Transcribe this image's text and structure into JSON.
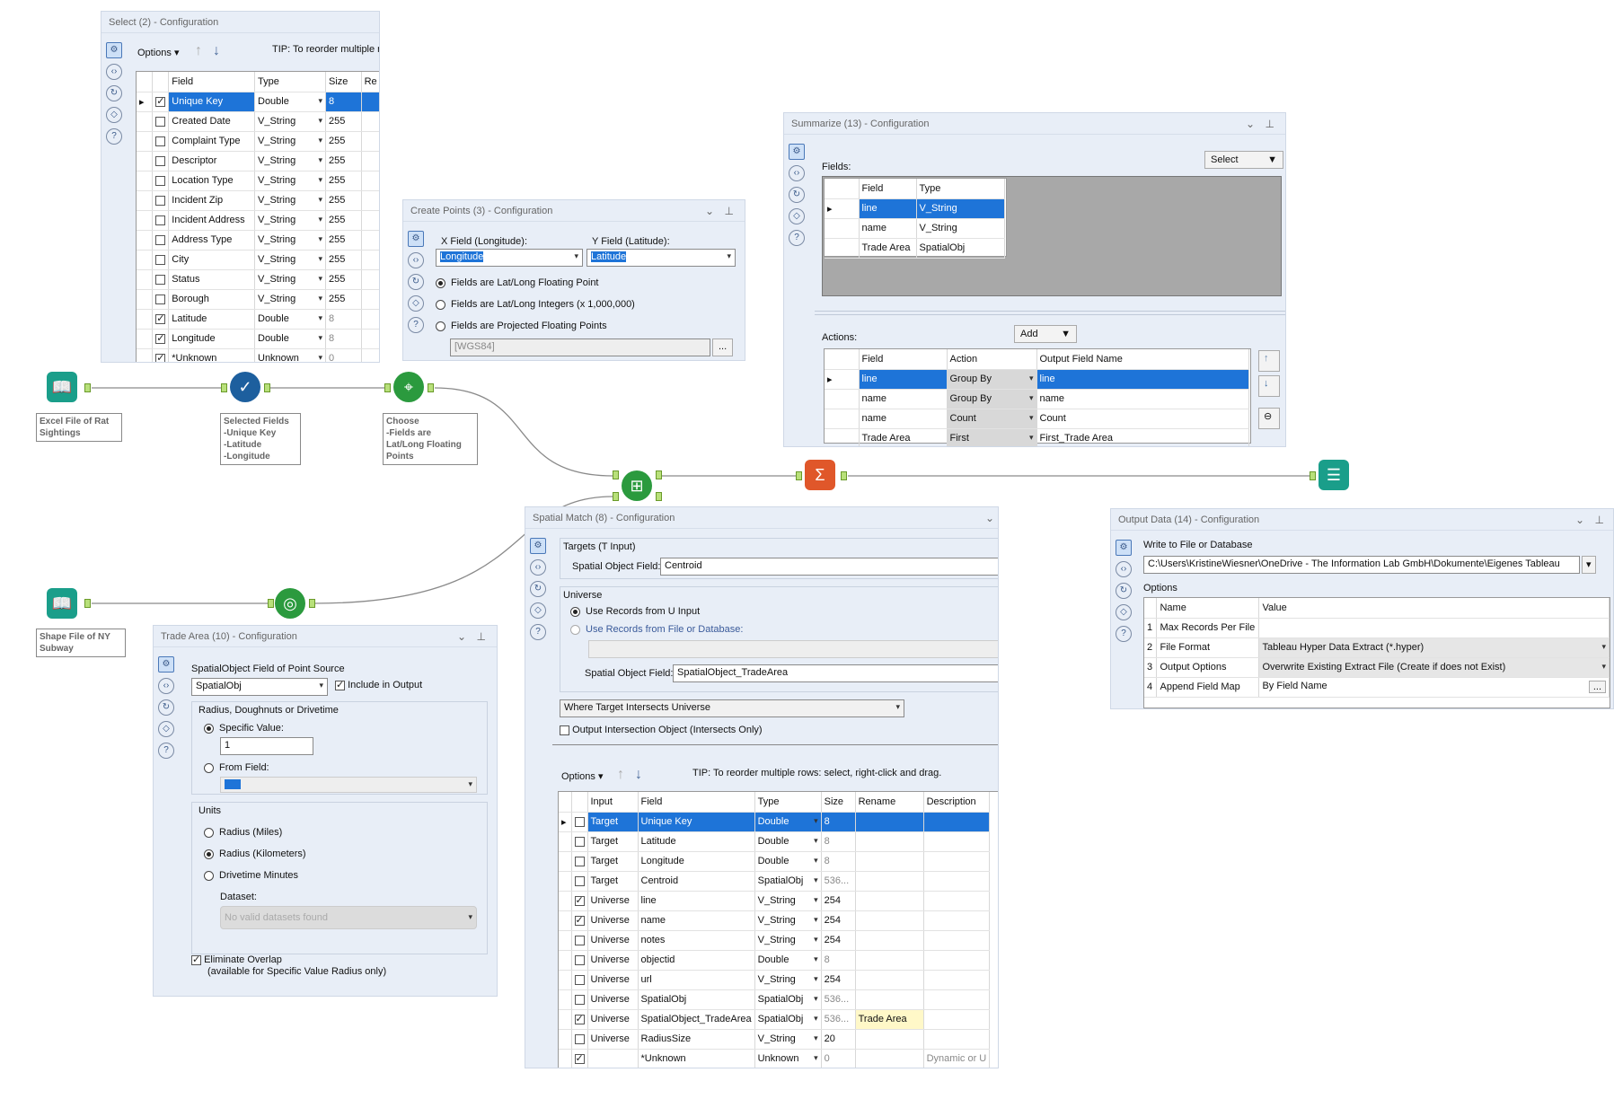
{
  "canvas": {
    "nodes": [
      {
        "id": "excel",
        "icon": "book-icon",
        "color": "#1a9e8a",
        "label": "Excel File of Rat Sightings"
      },
      {
        "id": "select",
        "icon": "check-icon",
        "color": "#1d5f9e",
        "label": "Selected Fields\n-Unique Key\n-Latitude\n-Longitude"
      },
      {
        "id": "createpoints",
        "icon": "pin-icon",
        "color": "#2b9a3e",
        "label": "Choose\n-Fields are\nLat/Long Floating\nPoints"
      },
      {
        "id": "spatialmatch",
        "icon": "match-icon",
        "color": "#2b9a3e",
        "label": ""
      },
      {
        "id": "summarize",
        "icon": "sigma-icon",
        "color": "#e0572a",
        "label": ""
      },
      {
        "id": "output",
        "icon": "output-icon",
        "color": "#1a9e8a",
        "label": ""
      },
      {
        "id": "subway",
        "icon": "book-icon",
        "color": "#1a9e8a",
        "label": "Shape File of NY Subway"
      },
      {
        "id": "tradearea",
        "icon": "target-icon",
        "color": "#2b9a3e",
        "label": ""
      }
    ],
    "anchors": {
      "t": "T",
      "u": "U",
      "m": "M",
      "d": "D"
    }
  },
  "select_panel": {
    "title": "Select (2) - Configuration",
    "options": "Options",
    "tip": "TIP: To reorder multiple ro",
    "headers": [
      "Field",
      "Type",
      "Size",
      "Re"
    ],
    "rows": [
      {
        "checked": true,
        "field": "Unique Key",
        "type": "Double",
        "size": "8",
        "selected": true
      },
      {
        "checked": false,
        "field": "Created Date",
        "type": "V_String",
        "size": "255"
      },
      {
        "checked": false,
        "field": "Complaint Type",
        "type": "V_String",
        "size": "255"
      },
      {
        "checked": false,
        "field": "Descriptor",
        "type": "V_String",
        "size": "255"
      },
      {
        "checked": false,
        "field": "Location Type",
        "type": "V_String",
        "size": "255"
      },
      {
        "checked": false,
        "field": "Incident Zip",
        "type": "V_String",
        "size": "255"
      },
      {
        "checked": false,
        "field": "Incident Address",
        "type": "V_String",
        "size": "255"
      },
      {
        "checked": false,
        "field": "Address Type",
        "type": "V_String",
        "size": "255"
      },
      {
        "checked": false,
        "field": "City",
        "type": "V_String",
        "size": "255"
      },
      {
        "checked": false,
        "field": "Status",
        "type": "V_String",
        "size": "255"
      },
      {
        "checked": false,
        "field": "Borough",
        "type": "V_String",
        "size": "255"
      },
      {
        "checked": true,
        "field": "Latitude",
        "type": "Double",
        "size": "8"
      },
      {
        "checked": true,
        "field": "Longitude",
        "type": "Double",
        "size": "8"
      },
      {
        "checked": true,
        "field": "*Unknown",
        "type": "Unknown",
        "size": "0"
      }
    ]
  },
  "create_points": {
    "title": "Create Points (3) - Configuration",
    "x_label": "X Field (Longitude):",
    "x_value": "Longitude",
    "y_label": "Y Field (Latitude):",
    "y_value": "Latitude",
    "opt1": "Fields are Lat/Long Floating Point",
    "opt2": "Fields are Lat/Long Integers (x 1,000,000)",
    "opt3": "Fields are Projected Floating Points",
    "proj": "[WGS84]",
    "proj_btn": "..."
  },
  "summarize": {
    "title": "Summarize (13) - Configuration",
    "fields_label": "Fields:",
    "select_btn": "Select",
    "field_headers": [
      "Field",
      "Type"
    ],
    "fields": [
      {
        "field": "line",
        "type": "V_String",
        "selected": true
      },
      {
        "field": "name",
        "type": "V_String"
      },
      {
        "field": "Trade Area",
        "type": "SpatialObj"
      }
    ],
    "add_btn": "Add",
    "actions_label": "Actions:",
    "action_headers": [
      "Field",
      "Action",
      "Output Field Name"
    ],
    "actions": [
      {
        "field": "line",
        "action": "Group By",
        "out": "line",
        "selected": true
      },
      {
        "field": "name",
        "action": "Group By",
        "out": "name"
      },
      {
        "field": "name",
        "action": "Count",
        "out": "Count"
      },
      {
        "field": "Trade Area",
        "action": "First",
        "out": "First_Trade Area"
      }
    ]
  },
  "spatial_match": {
    "title": "Spatial Match (8) - Configuration",
    "targets_label": "Targets (T Input)",
    "spatial_field_label": "Spatial Object Field:",
    "target_field": "Centroid",
    "universe_label": "Universe",
    "use_u": "Use Records from U Input",
    "use_file": "Use Records from File or Database:",
    "universe_field": "SpatialObject_TradeArea",
    "match_type": "Where Target Intersects Universe",
    "output_intersection": "Output Intersection Object (Intersects Only)",
    "options": "Options",
    "tip": "TIP: To reorder multiple rows: select, right-click and drag.",
    "headers": [
      "Input",
      "Field",
      "Type",
      "Size",
      "Rename",
      "Description"
    ],
    "rows": [
      {
        "checked": false,
        "input": "Target",
        "field": "Unique Key",
        "type": "Double",
        "size": "8",
        "rename": "",
        "desc": "",
        "selected": true
      },
      {
        "checked": false,
        "input": "Target",
        "field": "Latitude",
        "type": "Double",
        "size": "8",
        "rename": "",
        "desc": ""
      },
      {
        "checked": false,
        "input": "Target",
        "field": "Longitude",
        "type": "Double",
        "size": "8",
        "rename": "",
        "desc": ""
      },
      {
        "checked": false,
        "input": "Target",
        "field": "Centroid",
        "type": "SpatialObj",
        "size": "536...",
        "rename": "",
        "desc": ""
      },
      {
        "checked": true,
        "input": "Universe",
        "field": "line",
        "type": "V_String",
        "size": "254",
        "rename": "",
        "desc": ""
      },
      {
        "checked": true,
        "input": "Universe",
        "field": "name",
        "type": "V_String",
        "size": "254",
        "rename": "",
        "desc": ""
      },
      {
        "checked": false,
        "input": "Universe",
        "field": "notes",
        "type": "V_String",
        "size": "254",
        "rename": "",
        "desc": ""
      },
      {
        "checked": false,
        "input": "Universe",
        "field": "objectid",
        "type": "Double",
        "size": "8",
        "rename": "",
        "desc": ""
      },
      {
        "checked": false,
        "input": "Universe",
        "field": "url",
        "type": "V_String",
        "size": "254",
        "rename": "",
        "desc": ""
      },
      {
        "checked": false,
        "input": "Universe",
        "field": "SpatialObj",
        "type": "SpatialObj",
        "size": "536...",
        "rename": "",
        "desc": ""
      },
      {
        "checked": true,
        "input": "Universe",
        "field": "SpatialObject_TradeArea",
        "type": "SpatialObj",
        "size": "536...",
        "rename": "Trade Area",
        "desc": ""
      },
      {
        "checked": false,
        "input": "Universe",
        "field": "RadiusSize",
        "type": "V_String",
        "size": "20",
        "rename": "",
        "desc": ""
      },
      {
        "checked": true,
        "input": "",
        "field": "*Unknown",
        "type": "Unknown",
        "size": "0",
        "rename": "",
        "desc": "Dynamic or U"
      }
    ]
  },
  "output_data": {
    "title": "Output Data (14) - Configuration",
    "write_label": "Write to File or Database",
    "path": "C:\\Users\\KristineWiesner\\OneDrive - The Information Lab GmbH\\Dokumente\\Eigenes Tableau",
    "options_label": "Options",
    "headers": [
      "Name",
      "Value"
    ],
    "rows": [
      {
        "n": "1",
        "name": "Max Records Per File",
        "value": "",
        "dd": false
      },
      {
        "n": "2",
        "name": "File Format",
        "value": "Tableau Hyper Data Extract (*.hyper)",
        "dd": true
      },
      {
        "n": "3",
        "name": "Output Options",
        "value": "Overwrite Existing Extract File (Create if does not Exist)",
        "dd": true
      },
      {
        "n": "4",
        "name": "Append Field Map",
        "value": "By Field Name",
        "dd": false,
        "btn": "..."
      }
    ]
  },
  "trade_area": {
    "title": "Trade Area (10) - Configuration",
    "source_label": "SpatialObject Field of Point Source",
    "source_value": "SpatialObj",
    "include": "Include in Output",
    "radius_group": "Radius, Doughnuts or Drivetime",
    "specific": "Specific Value:",
    "specific_value": "1",
    "from_field": "From Field:",
    "units_label": "Units",
    "u1": "Radius (Miles)",
    "u2": "Radius (Kilometers)",
    "u3": "Drivetime Minutes",
    "dataset_label": "Dataset:",
    "dataset_value": "No valid datasets found",
    "eliminate": "Eliminate Overlap",
    "eliminate_note": "(available for Specific Value Radius only)"
  }
}
